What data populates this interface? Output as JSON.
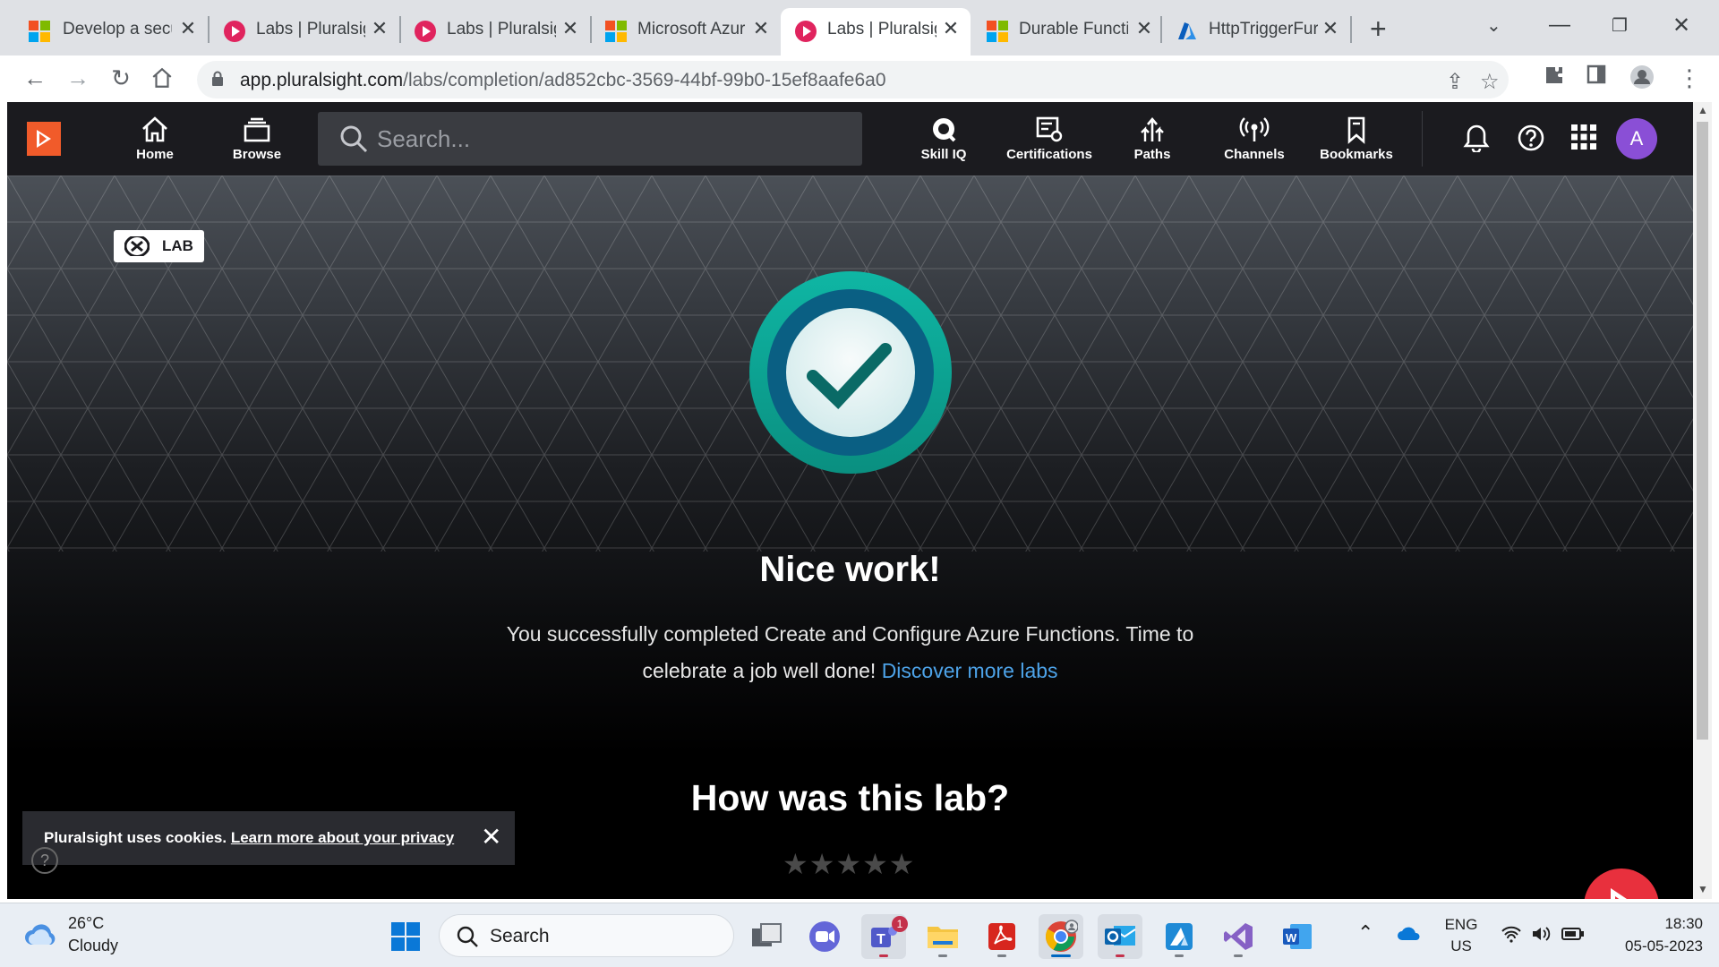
{
  "browser": {
    "tabs": [
      {
        "title": "Develop a secu",
        "favicon": "microsoft-icon"
      },
      {
        "title": "Labs | Pluralsig",
        "favicon": "pluralsight-icon"
      },
      {
        "title": "Labs | Pluralsig",
        "favicon": "pluralsight-icon"
      },
      {
        "title": "Microsoft Azur",
        "favicon": "microsoft-icon"
      },
      {
        "title": "Labs | Pluralsig",
        "favicon": "pluralsight-icon",
        "active": true
      },
      {
        "title": "Durable Functi",
        "favicon": "microsoft-icon"
      },
      {
        "title": "HttpTriggerFur",
        "favicon": "azure-icon"
      }
    ],
    "url_host": "app.pluralsight.com",
    "url_path": "/labs/completion/ad852cbc-3569-44bf-99b0-15ef8aafe6a0"
  },
  "nav": {
    "search_placeholder": "Search...",
    "items": [
      {
        "label": "Home",
        "icon": "home-icon"
      },
      {
        "label": "Browse",
        "icon": "browse-icon"
      }
    ],
    "right_items": [
      {
        "label": "Skill IQ",
        "icon": "skill-iq-icon"
      },
      {
        "label": "Certifications",
        "icon": "certifications-icon"
      },
      {
        "label": "Paths",
        "icon": "paths-icon"
      },
      {
        "label": "Channels",
        "icon": "channels-icon"
      },
      {
        "label": "Bookmarks",
        "icon": "bookmarks-icon"
      }
    ],
    "avatar_initial": "A"
  },
  "lab": {
    "badge": "LAB",
    "heading": "Nice work!",
    "message": "You successfully completed Create and Configure Azure Functions. Time to celebrate a job well done!",
    "link": "Discover more labs",
    "rating_heading": "How was this lab?",
    "rating_stars": 5,
    "rating_value": 0
  },
  "cookie": {
    "text": "Pluralsight uses cookies.",
    "link": "Learn more about your privacy"
  },
  "taskbar": {
    "weather_temp": "26°C",
    "weather_desc": "Cloudy",
    "search_label": "Search",
    "teams_badge": "1",
    "lang_top": "ENG",
    "lang_bottom": "US",
    "time": "18:30",
    "date": "05-05-2023"
  },
  "colors": {
    "brand": "#f15b2a",
    "accent_link": "#4da3e8",
    "check_ring": "#13a89e",
    "avatar": "#8a4fd6",
    "fab": "#e8303d"
  }
}
